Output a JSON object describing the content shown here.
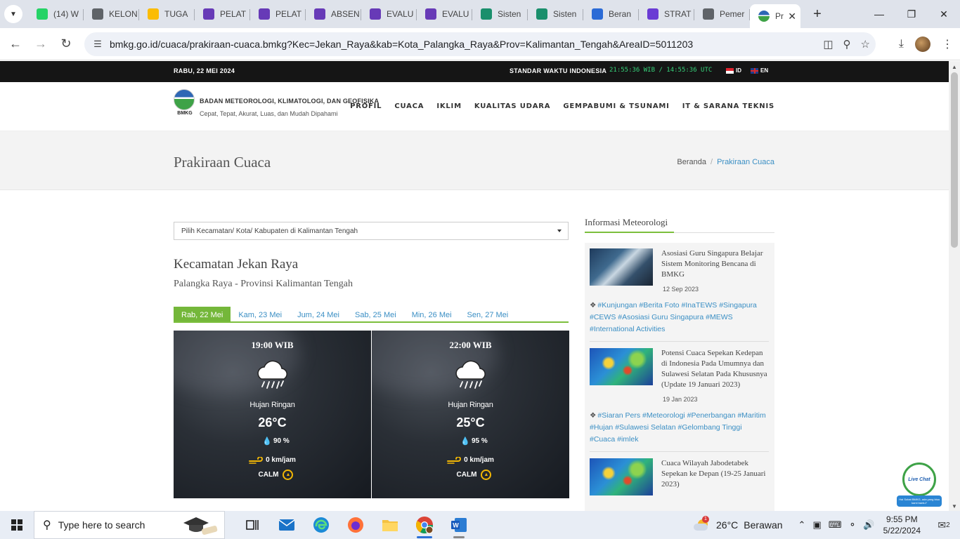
{
  "browser": {
    "tabs": [
      {
        "label": "(14) W",
        "color": "#25d366"
      },
      {
        "label": "KELON",
        "color": "#5f6368"
      },
      {
        "label": "TUGA",
        "color": "#fbbc04"
      },
      {
        "label": "PELAT",
        "color": "#673ab7"
      },
      {
        "label": "PELAT",
        "color": "#673ab7"
      },
      {
        "label": "ABSEN",
        "color": "#673ab7"
      },
      {
        "label": "EVALU",
        "color": "#673ab7"
      },
      {
        "label": "EVALU",
        "color": "#673ab7"
      },
      {
        "label": "Sisten",
        "color": "#1a8f6c"
      },
      {
        "label": "Sisten",
        "color": "#1a8f6c"
      },
      {
        "label": "Beran",
        "color": "#2b6bd6"
      },
      {
        "label": "STRAT",
        "color": "#6a3bd4"
      },
      {
        "label": "Pemer",
        "color": "#5f6368"
      }
    ],
    "active_tab": {
      "label": "Pr",
      "color": "#3ea247"
    },
    "url": "bmkg.go.id/cuaca/prakiraan-cuaca.bmkg?Kec=Jekan_Raya&kab=Kota_Palangka_Raya&Prov=Kalimantan_Tengah&AreaID=5011203"
  },
  "topbar": {
    "date": "RABU, 22 MEI 2024",
    "standard_time_label": "STANDAR WAKTU INDONESIA",
    "clock": "21:55:36 WIB / 14:55:36 UTC",
    "lang_id": "ID",
    "lang_en": "EN"
  },
  "header": {
    "logo_text": "BMKG",
    "org_name": "BADAN METEOROLOGI, KLIMATOLOGI, DAN GEOFISIKA",
    "tagline": "Cepat, Tepat, Akurat, Luas, dan Mudah Dipahami",
    "nav": [
      "PROFIL",
      "CUACA",
      "IKLIM",
      "KUALITAS UDARA",
      "GEMPABUMI & TSUNAMI",
      "IT & SARANA TEKNIS"
    ]
  },
  "title_band": {
    "title": "Prakiraan Cuaca",
    "breadcrumb_home": "Beranda",
    "breadcrumb_current": "Prakiraan Cuaca"
  },
  "forecast": {
    "select_placeholder": "Pilih Kecamatan/ Kota/ Kabupaten di Kalimantan Tengah",
    "kecamatan": "Kecamatan Jekan Raya",
    "province": "Palangka Raya - Provinsi Kalimantan Tengah",
    "day_tabs": [
      "Rab, 22 Mei",
      "Kam, 23 Mei",
      "Jum, 24 Mei",
      "Sab, 25 Mei",
      "Min, 26 Mei",
      "Sen, 27 Mei"
    ],
    "active_day": 0,
    "cards": [
      {
        "time": "19:00 WIB",
        "condition": "Hujan Ringan",
        "temp": "26°C",
        "humidity": "90 %",
        "wind": "0 km/jam",
        "direction": "CALM"
      },
      {
        "time": "22:00 WIB",
        "condition": "Hujan Ringan",
        "temp": "25°C",
        "humidity": "95 %",
        "wind": "0 km/jam",
        "direction": "CALM"
      }
    ]
  },
  "sidebar": {
    "heading": "Informasi Meteorologi",
    "news": [
      {
        "title": "Asosiasi Guru Singapura Belajar Sistem Monitoring Bencana di BMKG",
        "date": "12 Sep 2023",
        "tags": "#Kunjungan #Berita Foto #InaTEWS #Singapura #CEWS #Asosiasi Guru Singapura #MEWS #International Activities"
      },
      {
        "title": "Potensi Cuaca Sepekan Kedepan di Indonesia Pada Umumnya dan Sulawesi Selatan Pada Khususnya (Update 19 Januari 2023)",
        "date": "19 Jan 2023",
        "tags": "#Siaran Pers #Meteorologi #Penerbangan #Maritim #Hujan #Sulawesi Selatan #Gelombang Tinggi #Cuaca #imlek"
      },
      {
        "title": "Cuaca Wilayah Jabodetabek Sepekan ke Depan (19-25 Januari 2023)",
        "date": "",
        "tags": ""
      }
    ]
  },
  "livechat": {
    "label": "Live Chat",
    "sub": "Hai Sobat BMKG, ada yang bisa kami bantu?"
  },
  "taskbar": {
    "search_placeholder": "Type here to search",
    "weather_temp": "26°C",
    "weather_desc": "Berawan",
    "weather_badge": "1",
    "time": "9:55 PM",
    "date": "5/22/2024",
    "notifications": "2"
  }
}
